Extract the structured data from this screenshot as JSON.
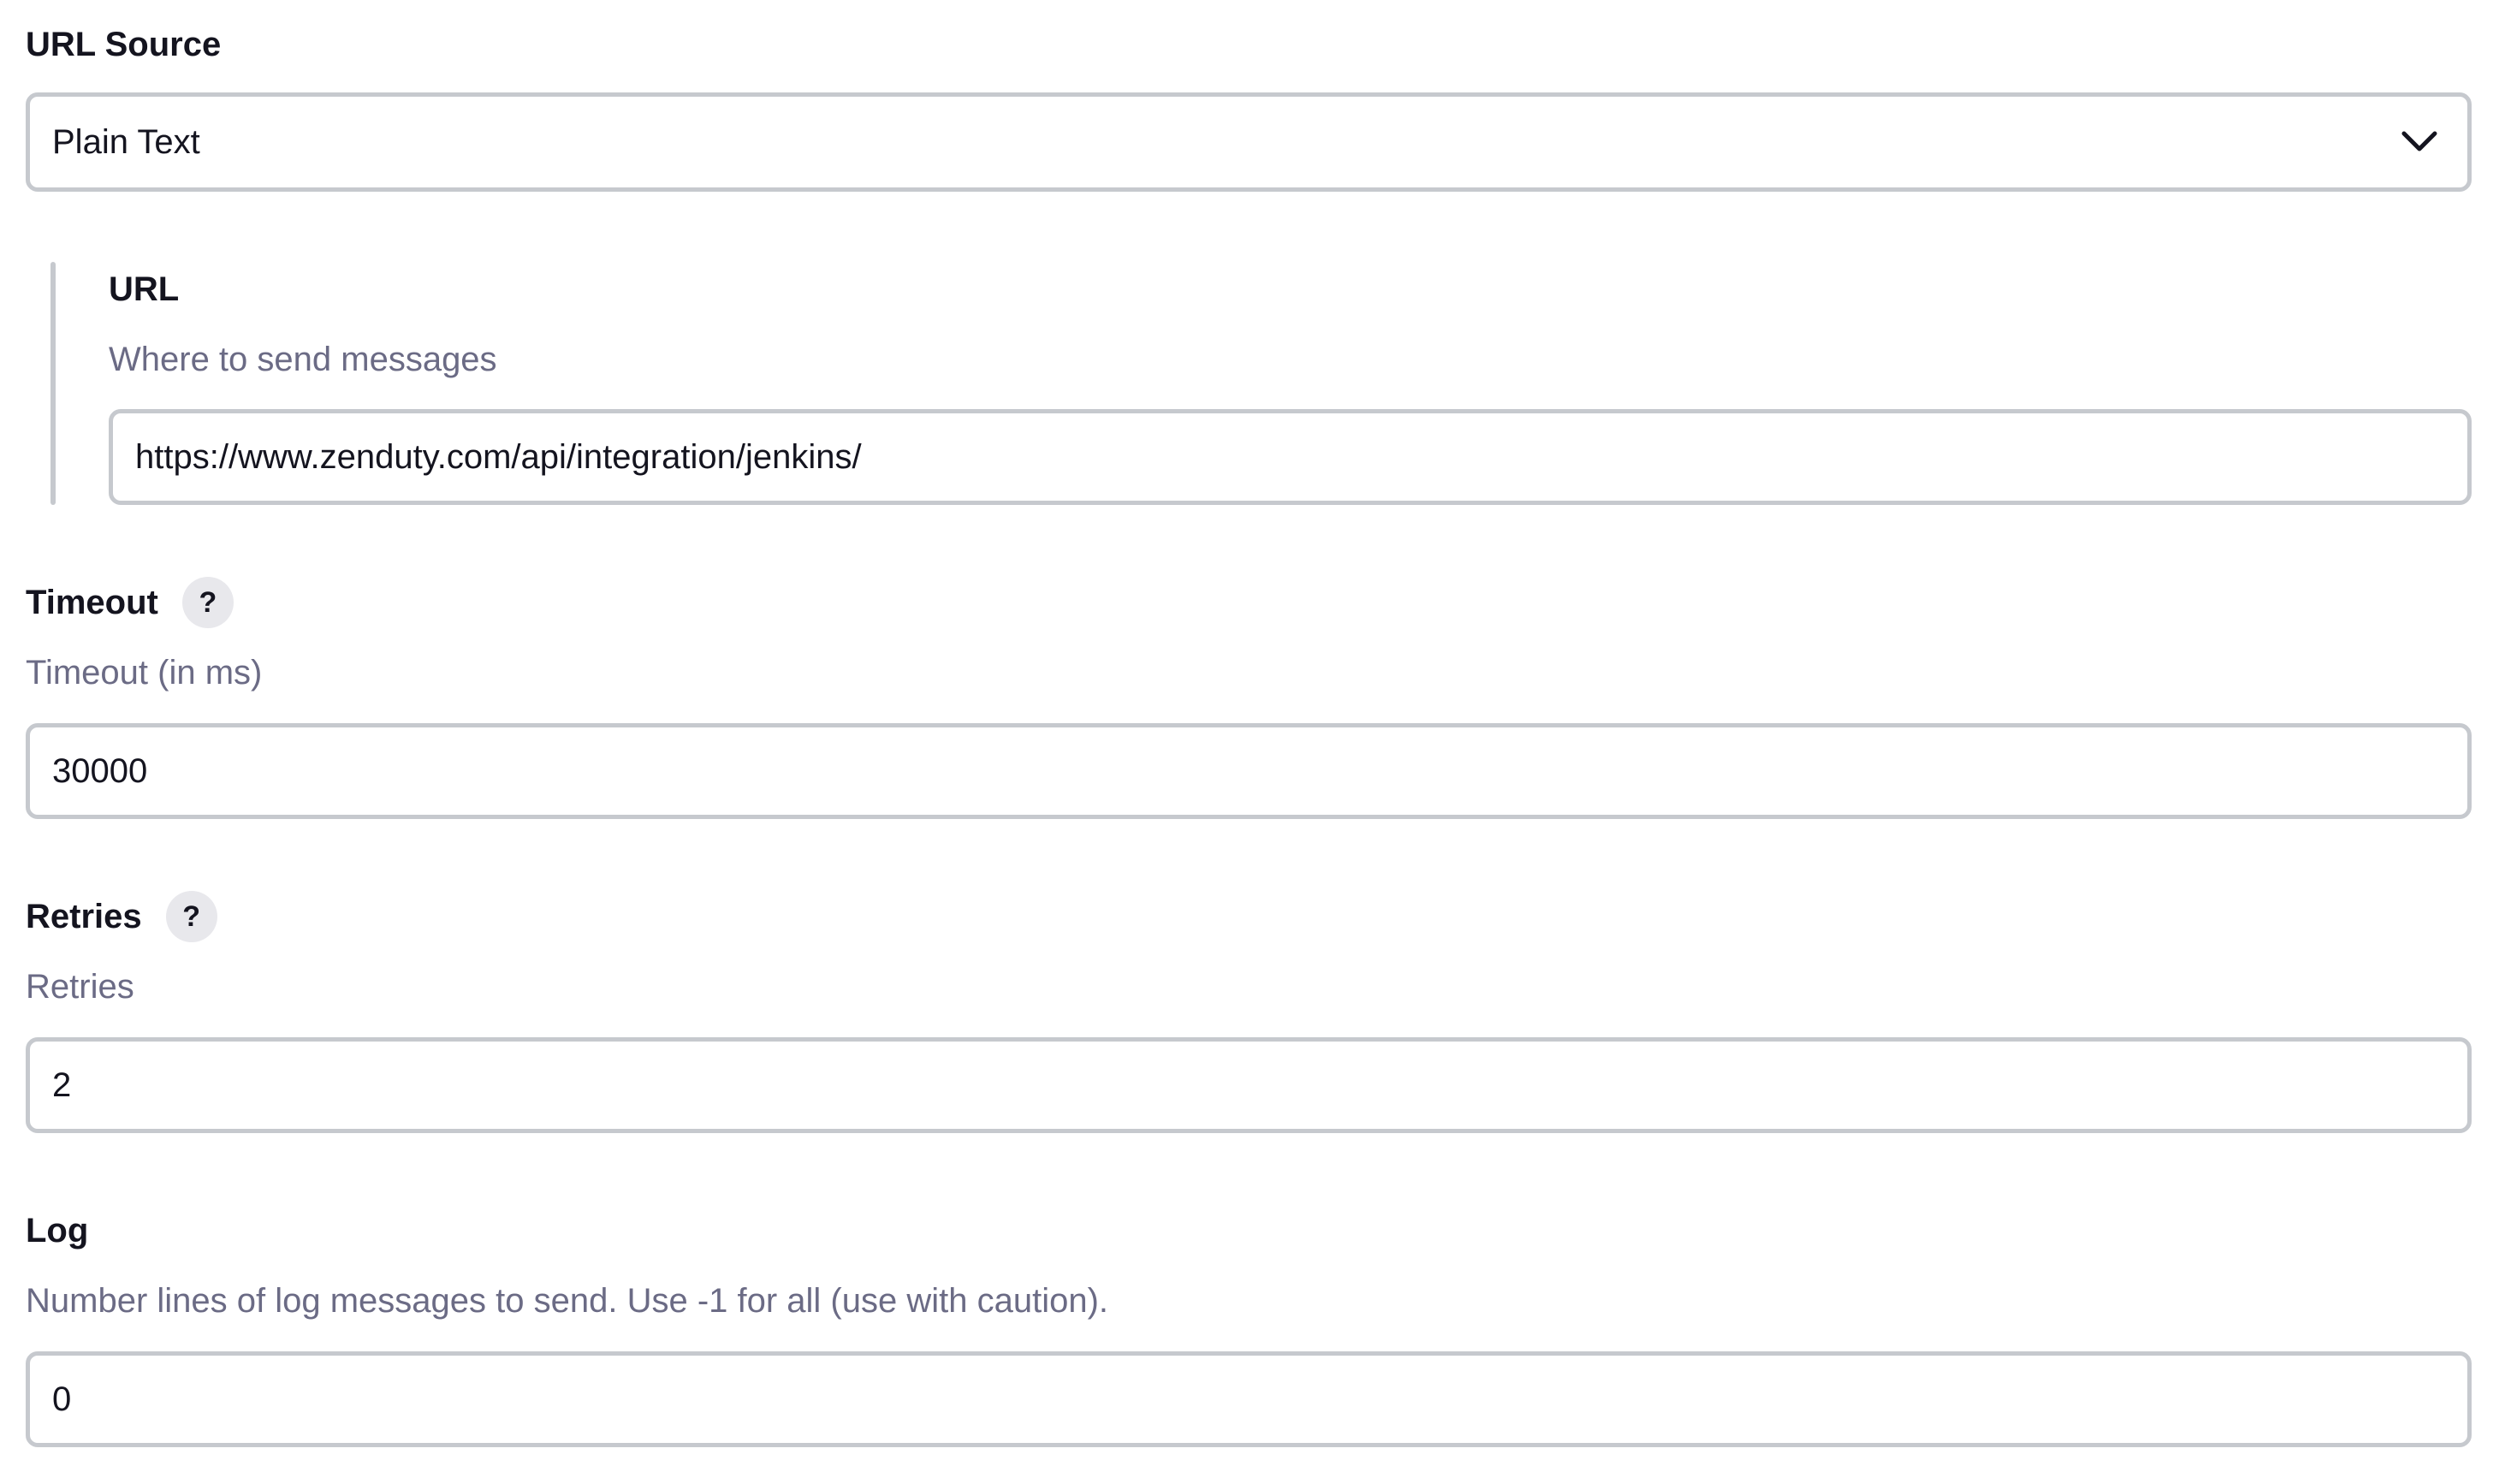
{
  "url_source": {
    "label": "URL Source",
    "selected": "Plain Text",
    "icon": "chevron-down-icon"
  },
  "url": {
    "label": "URL",
    "description": "Where to send messages",
    "value": "https://www.zenduty.com/api/integration/jenkins/"
  },
  "timeout": {
    "label": "Timeout",
    "help": "?",
    "description": "Timeout (in ms)",
    "value": "30000"
  },
  "retries": {
    "label": "Retries",
    "help": "?",
    "description": "Retries",
    "value": "2"
  },
  "log": {
    "label": "Log",
    "description": "Number lines of log messages to send. Use -1 for all (use with caution).",
    "value": "0"
  },
  "colors": {
    "text": "#14141f",
    "muted": "#6b6b85",
    "border": "#c6c9ce",
    "help_bg": "#e8e8ec"
  }
}
